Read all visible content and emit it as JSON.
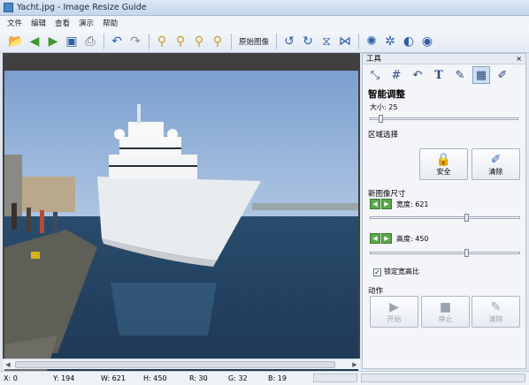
{
  "window": {
    "title": "Yacht.jpg - Image Resize Guide"
  },
  "menu": [
    "文件",
    "编辑",
    "查看",
    "演示",
    "帮助"
  ],
  "toolbar": {
    "original_image_label": "原始图像",
    "icons": [
      "open-icon",
      "back-icon",
      "forward-icon",
      "save-icon",
      "print-icon",
      "undo-icon",
      "redo-icon",
      "zoom-in-icon",
      "zoom-out-icon",
      "zoom-fit-icon",
      "zoom-actual-icon",
      "rotate-left-icon",
      "rotate-right-icon",
      "flip-vertical-icon",
      "flip-horizontal-icon",
      "settings-icon",
      "gear-icon",
      "contrast-icon",
      "info-icon"
    ]
  },
  "panel": {
    "header": "工具",
    "close": "×",
    "section_title": "智能调整",
    "size_label": "大小: 25",
    "size_value": 25,
    "region_title": "区域选择",
    "safe_button": "安全",
    "clear_button": "清除",
    "new_size_title": "新图像尺寸",
    "width_label": "宽度: 621",
    "height_label": "高度: 450",
    "lock_ratio_label": "锁定宽高比",
    "lock_ratio_checked": true,
    "actions_title": "动作",
    "start_button": "开始",
    "stop_button": "停止",
    "clear_action_button": "清除"
  },
  "status": {
    "x": "X: 0",
    "y": "Y: 194",
    "w": "W: 621",
    "h": "H: 450",
    "r": "R: 30",
    "g": "G: 32",
    "b": "B: 19"
  }
}
